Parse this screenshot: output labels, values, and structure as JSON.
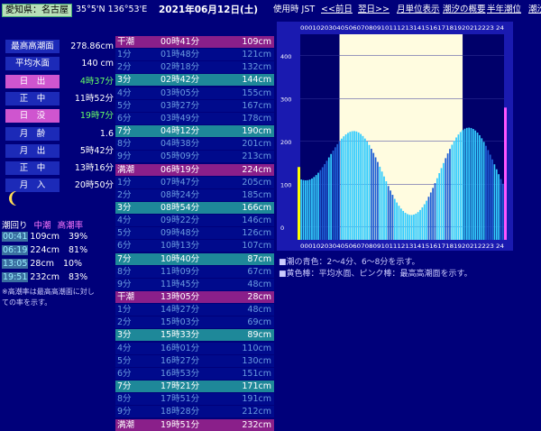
{
  "header": {
    "location": "愛知県：名古屋",
    "coords": "35°5'N 136°53'E",
    "date": "2021年06月12日(土)",
    "timezone": "使用時 JST",
    "nav_prev": "<<前日",
    "nav_next": "翌日>>",
    "nav_month": "月単位表示",
    "nav_summary": "潮汐の概要",
    "nav_half": "半年潮位",
    "nav_zero": "潮汐ゼロ"
  },
  "info": [
    {
      "label": "最高高潮面",
      "value": "278.86cm",
      "style": "b",
      "vstyle": ""
    },
    {
      "label": "平均水面",
      "value": "140 cm",
      "style": "b",
      "vstyle": ""
    },
    {
      "label": "日　出",
      "value": "4時37分",
      "style": "p",
      "vstyle": "g"
    },
    {
      "label": "正　中",
      "value": "11時52分",
      "style": "b",
      "vstyle": ""
    },
    {
      "label": "日　没",
      "value": "19時7分",
      "style": "p",
      "vstyle": "g"
    },
    {
      "label": "月　齢",
      "value": "1.6",
      "style": "b",
      "vstyle": ""
    },
    {
      "label": "月　出",
      "value": "5時42分",
      "style": "b",
      "vstyle": ""
    },
    {
      "label": "正　中",
      "value": "13時16分",
      "style": "b",
      "vstyle": ""
    },
    {
      "label": "月　入",
      "value": "20時50分",
      "style": "b",
      "vstyle": ""
    }
  ],
  "moon_icon": "crescent-moon-icon",
  "summary": {
    "headers": [
      "潮回り",
      "中潮",
      "高潮率"
    ],
    "rows": [
      {
        "time": "00:41",
        "level": "109cm",
        "rate": "39%"
      },
      {
        "time": "06:19",
        "level": "224cm",
        "rate": "81%"
      },
      {
        "time": "13:05",
        "level": "28cm",
        "rate": "10%"
      },
      {
        "time": "19:51",
        "level": "232cm",
        "rate": "83%"
      }
    ],
    "note": "※高潮率は最高高潮面に対しての率を示す。"
  },
  "tide_table": [
    {
      "label": "干潮",
      "time": "00時41分",
      "level": "109cm",
      "style": "mag"
    },
    {
      "label": "1分",
      "time": "01時48分",
      "level": "121cm",
      "style": "norm"
    },
    {
      "label": "2分",
      "time": "02時18分",
      "level": "132cm",
      "style": "norm"
    },
    {
      "label": "3分",
      "time": "02時42分",
      "level": "144cm",
      "style": "teal"
    },
    {
      "label": "4分",
      "time": "03時05分",
      "level": "155cm",
      "style": "norm"
    },
    {
      "label": "5分",
      "time": "03時27分",
      "level": "167cm",
      "style": "norm"
    },
    {
      "label": "6分",
      "time": "03時49分",
      "level": "178cm",
      "style": "norm"
    },
    {
      "label": "7分",
      "time": "04時12分",
      "level": "190cm",
      "style": "teal"
    },
    {
      "label": "8分",
      "time": "04時38分",
      "level": "201cm",
      "style": "norm"
    },
    {
      "label": "9分",
      "time": "05時09分",
      "level": "213cm",
      "style": "norm"
    },
    {
      "label": "満潮",
      "time": "06時19分",
      "level": "224cm",
      "style": "mag"
    },
    {
      "label": "1分",
      "time": "07時47分",
      "level": "205cm",
      "style": "norm"
    },
    {
      "label": "2分",
      "time": "08時24分",
      "level": "185cm",
      "style": "norm"
    },
    {
      "label": "3分",
      "time": "08時54分",
      "level": "166cm",
      "style": "teal"
    },
    {
      "label": "4分",
      "time": "09時22分",
      "level": "146cm",
      "style": "norm"
    },
    {
      "label": "5分",
      "time": "09時48分",
      "level": "126cm",
      "style": "norm"
    },
    {
      "label": "6分",
      "time": "10時13分",
      "level": "107cm",
      "style": "norm"
    },
    {
      "label": "7分",
      "time": "10時40分",
      "level": "87cm",
      "style": "teal"
    },
    {
      "label": "8分",
      "time": "11時09分",
      "level": "67cm",
      "style": "norm"
    },
    {
      "label": "9分",
      "time": "11時45分",
      "level": "48cm",
      "style": "norm"
    },
    {
      "label": "干潮",
      "time": "13時05分",
      "level": "28cm",
      "style": "mag"
    },
    {
      "label": "1分",
      "time": "14時27分",
      "level": "48cm",
      "style": "norm"
    },
    {
      "label": "2分",
      "time": "15時03分",
      "level": "69cm",
      "style": "norm"
    },
    {
      "label": "3分",
      "time": "15時33分",
      "level": "89cm",
      "style": "teal"
    },
    {
      "label": "4分",
      "time": "16時01分",
      "level": "110cm",
      "style": "norm"
    },
    {
      "label": "5分",
      "time": "16時27分",
      "level": "130cm",
      "style": "norm"
    },
    {
      "label": "6分",
      "time": "16時53分",
      "level": "151cm",
      "style": "norm"
    },
    {
      "label": "7分",
      "time": "17時21分",
      "level": "171cm",
      "style": "teal"
    },
    {
      "label": "8分",
      "time": "17時51分",
      "level": "191cm",
      "style": "norm"
    },
    {
      "label": "9分",
      "time": "18時28分",
      "level": "212cm",
      "style": "norm"
    },
    {
      "label": "満潮",
      "time": "19時51分",
      "level": "232cm",
      "style": "mag"
    }
  ],
  "notes": [
    "■潮の青色：2〜4分、6〜8分を示す。",
    "■黄色棒：平均水面、ピンク棒：最高高潮面を示す。"
  ],
  "colors": {
    "bg": "#00007a",
    "bar_light": "#33ccff",
    "bar_dark": "#1e5fd6",
    "bar_low": "#333366",
    "daylight": "#fffce0",
    "mean_bar": "#ffff00",
    "max_bar": "#ff55ff"
  },
  "chart_data": {
    "type": "bar",
    "x_label_top": "000102030405060708091011121314151617181920212223 24",
    "x_label_bottom": "000102030405060708091011121314151617181920212223 24",
    "hours": [
      "00",
      "01",
      "02",
      "03",
      "04",
      "05",
      "06",
      "07",
      "08",
      "09",
      "10",
      "11",
      "12",
      "13",
      "14",
      "15",
      "16",
      "17",
      "18",
      "19",
      "20",
      "21",
      "22",
      "23",
      "24"
    ],
    "yticks": [
      400,
      300,
      200,
      100,
      0
    ],
    "ylim": [
      -30,
      450
    ],
    "daylight_hours": [
      4.62,
      19.12
    ],
    "mean_level": 140,
    "max_level": 278.86,
    "tide_points": [
      {
        "t": 0.68,
        "v": 109
      },
      {
        "t": 6.32,
        "v": 224
      },
      {
        "t": 13.08,
        "v": 28
      },
      {
        "t": 19.85,
        "v": 232
      }
    ]
  }
}
